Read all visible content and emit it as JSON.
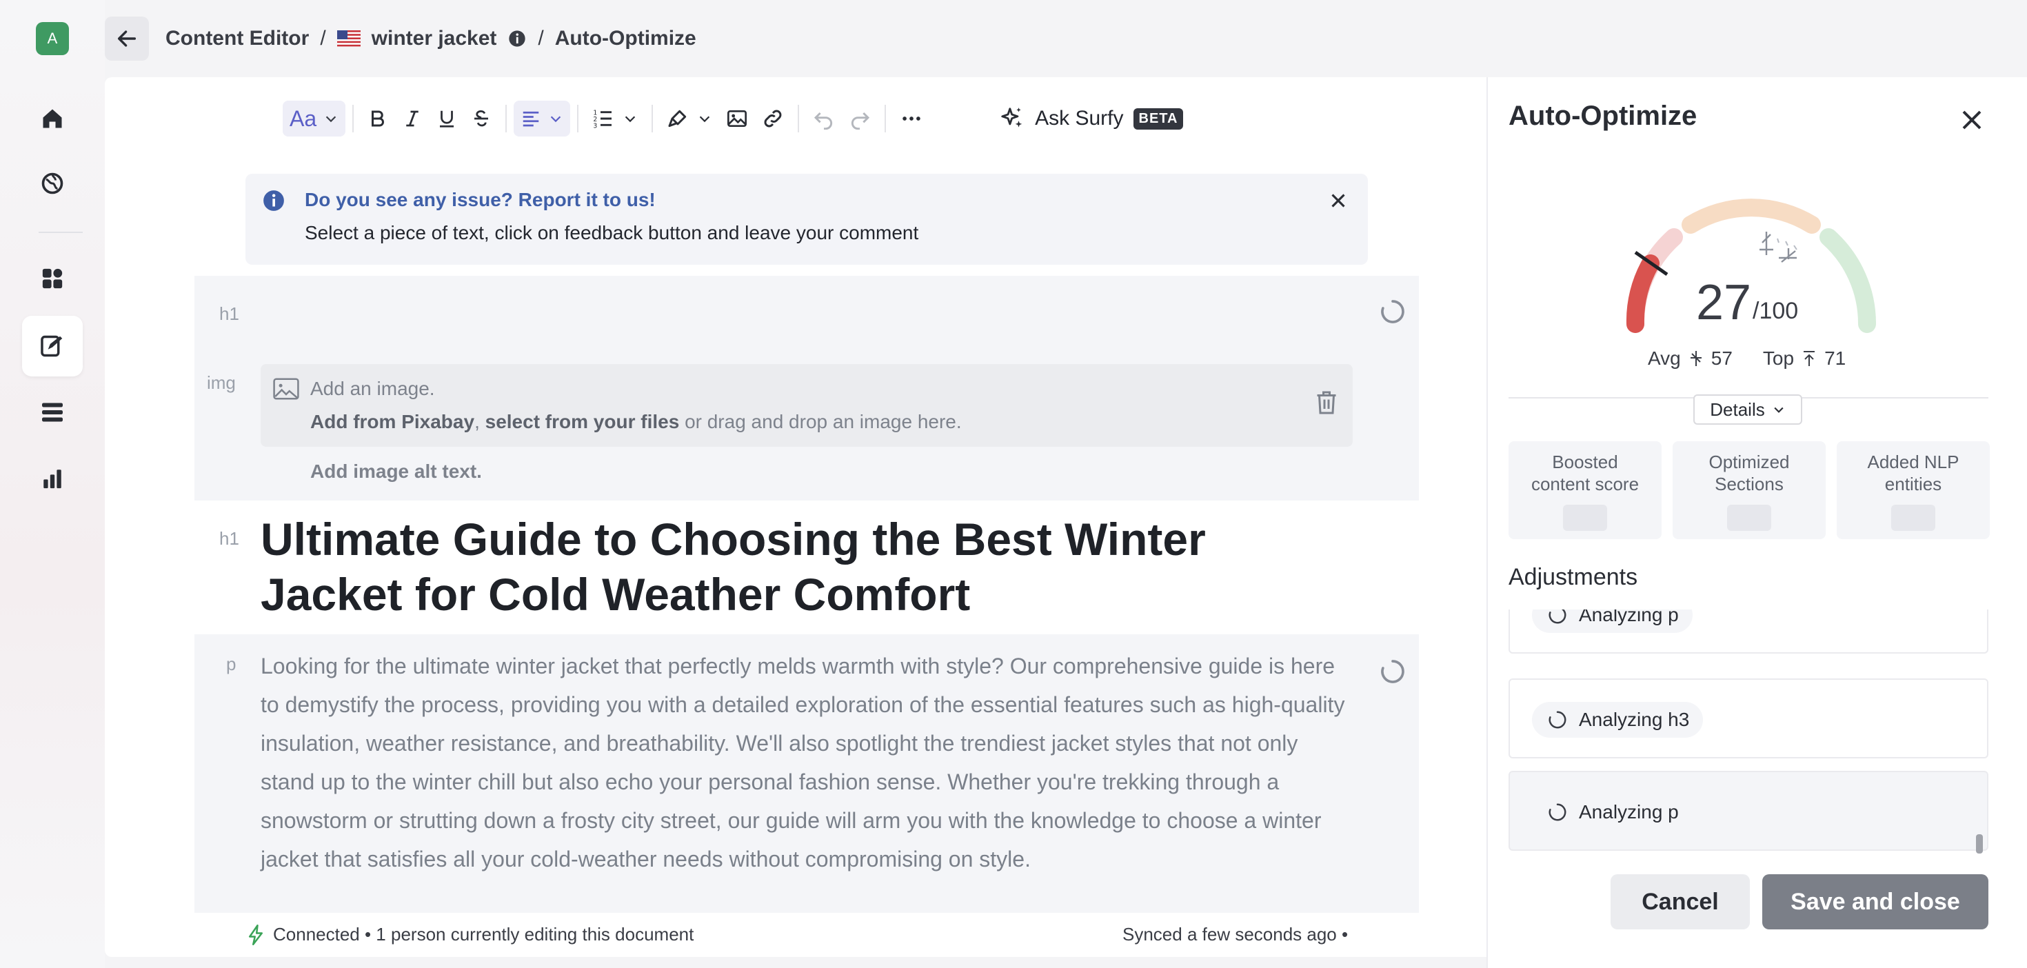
{
  "user": {
    "avatar_initial": "A"
  },
  "breadcrumb": {
    "root": "Content Editor",
    "sep": "/",
    "keyword": "winter jacket",
    "current": "Auto-Optimize"
  },
  "toolbar": {
    "font_label": "Aa",
    "ask_label": "Ask Surfy",
    "beta_label": "BETA"
  },
  "banner": {
    "title": "Do you see any issue? Report it to us!",
    "text": "Select a piece of text, click on feedback button and leave your comment"
  },
  "editor": {
    "tag_h1": "h1",
    "tag_img": "img",
    "tag_p": "p",
    "img_add": "Add an image.",
    "img_pixabay": "Add from Pixabay",
    "img_comma": ",",
    "img_files": "select from your files",
    "img_drag": "or drag and drop an image here.",
    "img_alt": "Add image alt text.",
    "heading": "Ultimate Guide to Choosing the Best Winter Jacket for Cold Weather Comfort",
    "paragraph": "Looking for the ultimate winter jacket that perfectly melds warmth with style? Our comprehensive guide is here to demystify the process, providing you with a detailed exploration of the essential features such as high-quality insulation, weather resistance, and breathability. We'll also spotlight the trendiest jacket styles that not only stand up to the winter chill but also echo your personal fashion sense. Whether you're trekking through a snowstorm or strutting down a frosty city street, our guide will arm you with the knowledge to choose a winter jacket that satisfies all your cold-weather needs without compromising on style."
  },
  "status": {
    "connected": "Connected • 1 person currently editing this document",
    "synced": "Synced a few seconds ago •"
  },
  "panel": {
    "title": "Auto-Optimize",
    "score": "27",
    "score_max": "/100",
    "score_value": 27,
    "avg_label": "Avg",
    "avg_value": "57",
    "top_label": "Top",
    "top_value": "71",
    "details_label": "Details",
    "stats": [
      "Boosted content score",
      "Optimized Sections",
      "Added NLP entities"
    ],
    "adjustments_title": "Adjustments",
    "adjustments": [
      "Analyzing p",
      "Analyzing h3",
      "Analyzing p"
    ],
    "cancel_label": "Cancel",
    "save_label": "Save and close"
  },
  "colors": {
    "accent": "#5b5fc7",
    "banner_title": "#3f5fa8",
    "gauge_red": "#d9534f",
    "gauge_peach": "#f7dcc4",
    "gauge_green": "#d6ecd9",
    "connected_green": "#3aa357"
  }
}
